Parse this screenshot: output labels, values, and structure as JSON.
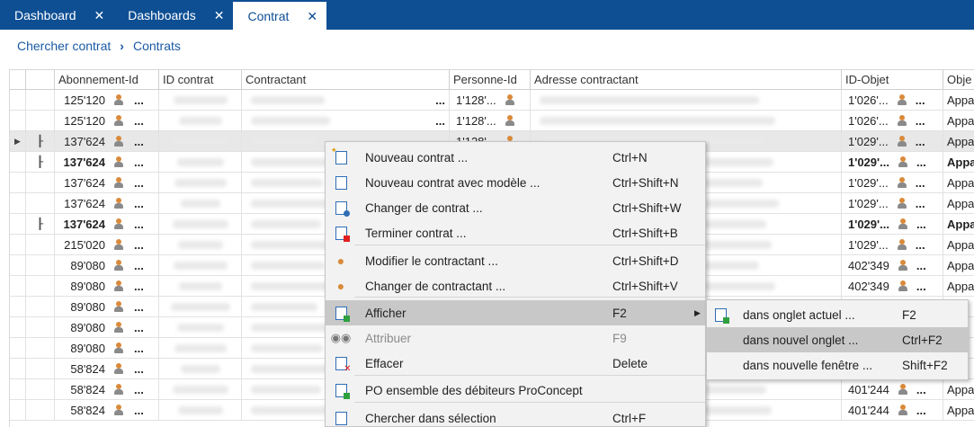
{
  "tabs": [
    {
      "label": "Dashboard",
      "close": "✕",
      "active": false
    },
    {
      "label": "Dashboards",
      "close": "✕",
      "active": false
    },
    {
      "label": "Contrat",
      "close": "✕",
      "active": true
    }
  ],
  "breadcrumb": {
    "item1": "Chercher contrat",
    "sep": "›",
    "item2": "Contrats"
  },
  "grid": {
    "columns": [
      "Abonnement-Id",
      "ID contrat",
      "Contractant",
      "Personne-Id",
      "Adresse contractant",
      "ID-Objet",
      "Obje"
    ],
    "rows": [
      {
        "indicator": "",
        "tree": false,
        "abo": "125'120",
        "pid": "1'128'...",
        "oid": "1'026'...",
        "obj": "Appa",
        "bold": false,
        "selected": false
      },
      {
        "indicator": "",
        "tree": false,
        "abo": "125'120",
        "pid": "1'128'...",
        "oid": "1'026'...",
        "obj": "Appa",
        "bold": false,
        "selected": false
      },
      {
        "indicator": "▶",
        "tree": true,
        "abo": "137'624",
        "pid": "1'128'...",
        "oid": "1'029'...",
        "obj": "Appa",
        "bold": false,
        "selected": true
      },
      {
        "indicator": "",
        "tree": true,
        "abo": "137'624",
        "pid": "",
        "oid": "1'029'...",
        "obj": "Appa",
        "bold": true,
        "selected": false
      },
      {
        "indicator": "",
        "tree": false,
        "abo": "137'624",
        "pid": "",
        "oid": "1'029'...",
        "obj": "Appa",
        "bold": false,
        "selected": false
      },
      {
        "indicator": "",
        "tree": false,
        "abo": "137'624",
        "pid": "",
        "oid": "1'029'...",
        "obj": "Appa",
        "bold": false,
        "selected": false
      },
      {
        "indicator": "",
        "tree": true,
        "abo": "137'624",
        "pid": "",
        "oid": "1'029'...",
        "obj": "Appa",
        "bold": true,
        "selected": false
      },
      {
        "indicator": "",
        "tree": false,
        "abo": "215'020",
        "pid": "",
        "oid": "1'029'...",
        "obj": "Appa",
        "bold": false,
        "selected": false
      },
      {
        "indicator": "",
        "tree": false,
        "abo": "89'080",
        "pid": "",
        "oid": "402'349",
        "obj": "Appa",
        "bold": false,
        "selected": false
      },
      {
        "indicator": "",
        "tree": false,
        "abo": "89'080",
        "pid": "",
        "oid": "402'349",
        "obj": "Appa",
        "bold": false,
        "selected": false
      },
      {
        "indicator": "",
        "tree": false,
        "abo": "89'080",
        "pid": "",
        "oid": "",
        "obj": "",
        "bold": false,
        "selected": false
      },
      {
        "indicator": "",
        "tree": false,
        "abo": "89'080",
        "pid": "",
        "oid": "",
        "obj": "",
        "bold": false,
        "selected": false
      },
      {
        "indicator": "",
        "tree": false,
        "abo": "89'080",
        "pid": "",
        "oid": "",
        "obj": "",
        "bold": false,
        "selected": false
      },
      {
        "indicator": "",
        "tree": false,
        "abo": "58'824",
        "pid": "",
        "oid": "",
        "obj": "",
        "bold": false,
        "selected": false
      },
      {
        "indicator": "",
        "tree": false,
        "abo": "58'824",
        "pid": "",
        "oid": "401'244",
        "obj": "Appa",
        "bold": false,
        "selected": false
      },
      {
        "indicator": "",
        "tree": false,
        "abo": "58'824",
        "pid": "",
        "oid": "401'244",
        "obj": "Appa",
        "bold": false,
        "selected": false
      }
    ],
    "dots": "..."
  },
  "context_menu": {
    "items": [
      {
        "label": "Nouveau contrat ...",
        "shortcut": "Ctrl+N",
        "icon": "new-contract-icon",
        "cls": "star"
      },
      {
        "label": "Nouveau contrat avec modèle ...",
        "shortcut": "Ctrl+Shift+N",
        "icon": "contract-template-icon",
        "cls": ""
      },
      {
        "label": "Changer de contrat ...",
        "shortcut": "Ctrl+Shift+W",
        "icon": "change-contract-icon",
        "cls": "blu"
      },
      {
        "label": "Terminer contrat ...",
        "shortcut": "Ctrl+Shift+B",
        "icon": "terminate-contract-icon",
        "cls": "red"
      },
      {
        "label": "Modifier le contractant ...",
        "shortcut": "Ctrl+Shift+D",
        "icon": "edit-contractor-icon",
        "cls": ""
      },
      {
        "label": "Changer de contractant ...",
        "shortcut": "Ctrl+Shift+V",
        "icon": "change-contractor-icon",
        "cls": ""
      },
      {
        "label": "Afficher",
        "shortcut": "F2",
        "icon": "display-icon",
        "cls": "grn",
        "submenu": true
      },
      {
        "label": "Attribuer",
        "shortcut": "F9",
        "icon": "binoculars-icon",
        "cls": "",
        "disabled": true
      },
      {
        "label": "Effacer",
        "shortcut": "Delete",
        "icon": "delete-icon",
        "cls": "xred"
      },
      {
        "label": "PO ensemble des débiteurs ProConcept",
        "shortcut": "",
        "icon": "debtors-icon",
        "cls": "grn"
      },
      {
        "label": "Chercher dans sélection",
        "shortcut": "Ctrl+F",
        "icon": "search-selection-icon",
        "cls": ""
      }
    ],
    "arrow": "▶"
  },
  "submenu": {
    "items": [
      {
        "label": "dans onglet actuel ...",
        "shortcut": "F2",
        "icon": "current-tab-icon"
      },
      {
        "label": "dans nouvel onglet ...",
        "shortcut": "Ctrl+F2",
        "icon": ""
      },
      {
        "label": "dans nouvelle fenêtre ...",
        "shortcut": "Shift+F2",
        "icon": ""
      }
    ]
  },
  "colors": {
    "tabbar": "#0e4f94",
    "link": "#1a5aa6",
    "menu_bg": "#f2f2f2",
    "menu_highlight": "#c8c8c8"
  }
}
